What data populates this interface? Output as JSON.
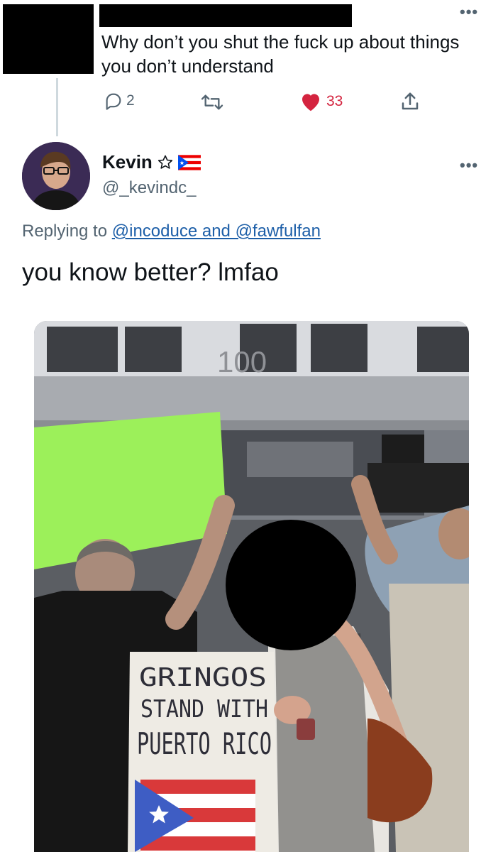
{
  "parent_tweet": {
    "text": "Why don’t you shut the fuck up about things you don’t understand",
    "reply_count": "2",
    "like_count": "33"
  },
  "reply_tweet": {
    "name": "Kevin",
    "handle": "@_kevindc_",
    "replying_prefix": "Replying to ",
    "replying_to": "@incoduce and @fawfulfan",
    "text": "you know better? lmfao"
  },
  "media": {
    "building_number": "100",
    "sign_lines": [
      "GRINGOS",
      "STAND WITH",
      "PUERTO RICO"
    ]
  },
  "colors": {
    "like_red": "#d4243f",
    "link_blue": "#1d5fa8",
    "secondary_gray": "#536471",
    "sign_green": "#9cf05a"
  },
  "icons": [
    "reply-icon",
    "retweet-icon",
    "heart-icon",
    "share-icon",
    "more-icon",
    "star-icon",
    "puerto-rico-flag-icon"
  ]
}
